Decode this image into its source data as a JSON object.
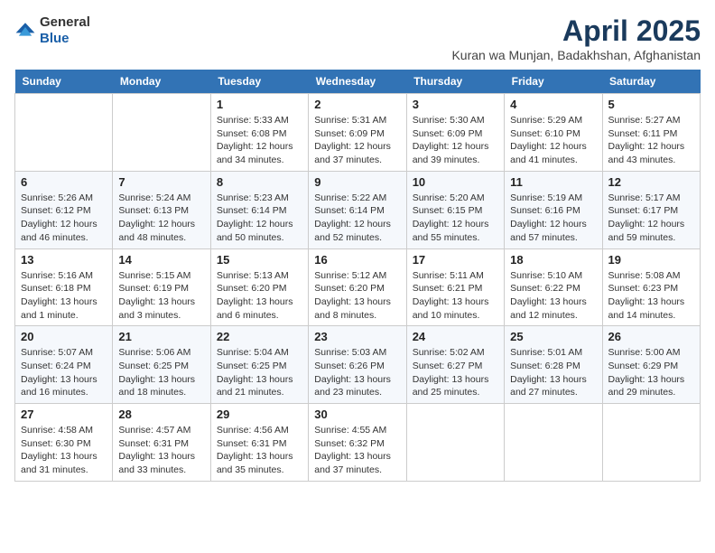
{
  "header": {
    "logo_line1": "General",
    "logo_line2": "Blue",
    "title": "April 2025",
    "subtitle": "Kuran wa Munjan, Badakhshan, Afghanistan"
  },
  "days_of_week": [
    "Sunday",
    "Monday",
    "Tuesday",
    "Wednesday",
    "Thursday",
    "Friday",
    "Saturday"
  ],
  "weeks": [
    [
      {
        "day": "",
        "info": ""
      },
      {
        "day": "",
        "info": ""
      },
      {
        "day": "1",
        "info": "Sunrise: 5:33 AM\nSunset: 6:08 PM\nDaylight: 12 hours and 34 minutes."
      },
      {
        "day": "2",
        "info": "Sunrise: 5:31 AM\nSunset: 6:09 PM\nDaylight: 12 hours and 37 minutes."
      },
      {
        "day": "3",
        "info": "Sunrise: 5:30 AM\nSunset: 6:09 PM\nDaylight: 12 hours and 39 minutes."
      },
      {
        "day": "4",
        "info": "Sunrise: 5:29 AM\nSunset: 6:10 PM\nDaylight: 12 hours and 41 minutes."
      },
      {
        "day": "5",
        "info": "Sunrise: 5:27 AM\nSunset: 6:11 PM\nDaylight: 12 hours and 43 minutes."
      }
    ],
    [
      {
        "day": "6",
        "info": "Sunrise: 5:26 AM\nSunset: 6:12 PM\nDaylight: 12 hours and 46 minutes."
      },
      {
        "day": "7",
        "info": "Sunrise: 5:24 AM\nSunset: 6:13 PM\nDaylight: 12 hours and 48 minutes."
      },
      {
        "day": "8",
        "info": "Sunrise: 5:23 AM\nSunset: 6:14 PM\nDaylight: 12 hours and 50 minutes."
      },
      {
        "day": "9",
        "info": "Sunrise: 5:22 AM\nSunset: 6:14 PM\nDaylight: 12 hours and 52 minutes."
      },
      {
        "day": "10",
        "info": "Sunrise: 5:20 AM\nSunset: 6:15 PM\nDaylight: 12 hours and 55 minutes."
      },
      {
        "day": "11",
        "info": "Sunrise: 5:19 AM\nSunset: 6:16 PM\nDaylight: 12 hours and 57 minutes."
      },
      {
        "day": "12",
        "info": "Sunrise: 5:17 AM\nSunset: 6:17 PM\nDaylight: 12 hours and 59 minutes."
      }
    ],
    [
      {
        "day": "13",
        "info": "Sunrise: 5:16 AM\nSunset: 6:18 PM\nDaylight: 13 hours and 1 minute."
      },
      {
        "day": "14",
        "info": "Sunrise: 5:15 AM\nSunset: 6:19 PM\nDaylight: 13 hours and 3 minutes."
      },
      {
        "day": "15",
        "info": "Sunrise: 5:13 AM\nSunset: 6:20 PM\nDaylight: 13 hours and 6 minutes."
      },
      {
        "day": "16",
        "info": "Sunrise: 5:12 AM\nSunset: 6:20 PM\nDaylight: 13 hours and 8 minutes."
      },
      {
        "day": "17",
        "info": "Sunrise: 5:11 AM\nSunset: 6:21 PM\nDaylight: 13 hours and 10 minutes."
      },
      {
        "day": "18",
        "info": "Sunrise: 5:10 AM\nSunset: 6:22 PM\nDaylight: 13 hours and 12 minutes."
      },
      {
        "day": "19",
        "info": "Sunrise: 5:08 AM\nSunset: 6:23 PM\nDaylight: 13 hours and 14 minutes."
      }
    ],
    [
      {
        "day": "20",
        "info": "Sunrise: 5:07 AM\nSunset: 6:24 PM\nDaylight: 13 hours and 16 minutes."
      },
      {
        "day": "21",
        "info": "Sunrise: 5:06 AM\nSunset: 6:25 PM\nDaylight: 13 hours and 18 minutes."
      },
      {
        "day": "22",
        "info": "Sunrise: 5:04 AM\nSunset: 6:25 PM\nDaylight: 13 hours and 21 minutes."
      },
      {
        "day": "23",
        "info": "Sunrise: 5:03 AM\nSunset: 6:26 PM\nDaylight: 13 hours and 23 minutes."
      },
      {
        "day": "24",
        "info": "Sunrise: 5:02 AM\nSunset: 6:27 PM\nDaylight: 13 hours and 25 minutes."
      },
      {
        "day": "25",
        "info": "Sunrise: 5:01 AM\nSunset: 6:28 PM\nDaylight: 13 hours and 27 minutes."
      },
      {
        "day": "26",
        "info": "Sunrise: 5:00 AM\nSunset: 6:29 PM\nDaylight: 13 hours and 29 minutes."
      }
    ],
    [
      {
        "day": "27",
        "info": "Sunrise: 4:58 AM\nSunset: 6:30 PM\nDaylight: 13 hours and 31 minutes."
      },
      {
        "day": "28",
        "info": "Sunrise: 4:57 AM\nSunset: 6:31 PM\nDaylight: 13 hours and 33 minutes."
      },
      {
        "day": "29",
        "info": "Sunrise: 4:56 AM\nSunset: 6:31 PM\nDaylight: 13 hours and 35 minutes."
      },
      {
        "day": "30",
        "info": "Sunrise: 4:55 AM\nSunset: 6:32 PM\nDaylight: 13 hours and 37 minutes."
      },
      {
        "day": "",
        "info": ""
      },
      {
        "day": "",
        "info": ""
      },
      {
        "day": "",
        "info": ""
      }
    ]
  ]
}
